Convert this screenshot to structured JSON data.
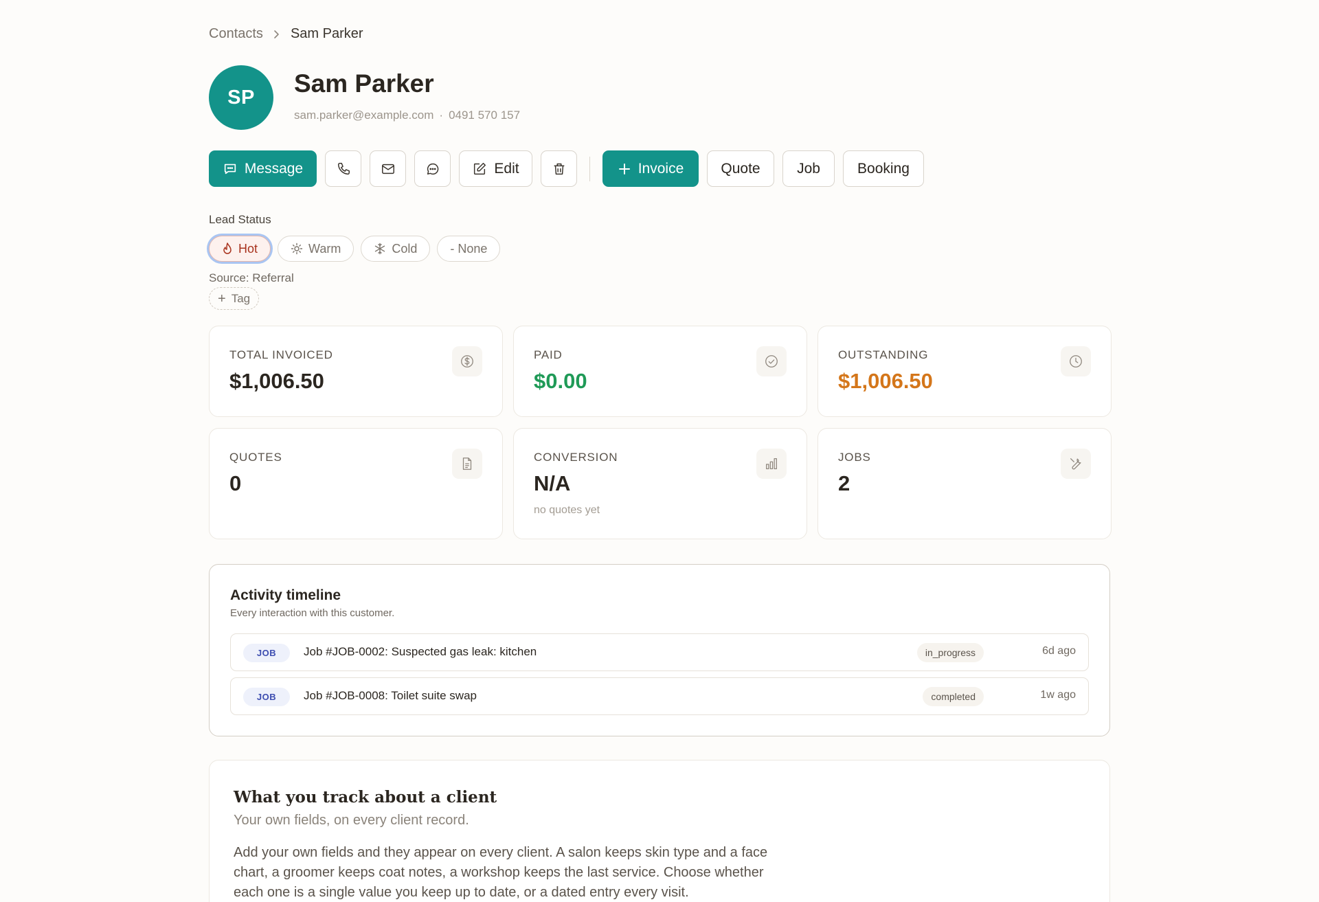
{
  "breadcrumb": {
    "parent": "Contacts",
    "current": "Sam Parker"
  },
  "contact": {
    "initials": "SP",
    "name": "Sam Parker",
    "email": "sam.parker@example.com",
    "separator": "·",
    "phone": "0491 570 157"
  },
  "actions": {
    "message": "Message",
    "edit": "Edit",
    "invoice": "Invoice",
    "quote": "Quote",
    "job": "Job",
    "booking": "Booking",
    "icons": [
      "chat-bubble-icon",
      "phone-icon",
      "mail-icon",
      "sms-icon",
      "pencil-icon",
      "trash-icon",
      "plus-icon"
    ]
  },
  "lead_status": {
    "label": "Lead Status",
    "options": [
      {
        "label": "Hot",
        "icon": "flame-icon",
        "selected": true
      },
      {
        "label": "Warm",
        "icon": "sun-icon",
        "selected": false
      },
      {
        "label": "Cold",
        "icon": "snowflake-icon",
        "selected": false
      },
      {
        "label": "- None",
        "icon": "",
        "selected": false
      }
    ]
  },
  "source": "Source: Referral",
  "tag_button": {
    "plus": "+",
    "label": "Tag"
  },
  "stats": [
    {
      "label": "TOTAL INVOICED",
      "value": "$1,006.50",
      "icon": "dollar-circle-icon",
      "color": "#2b2620"
    },
    {
      "label": "PAID",
      "value": "$0.00",
      "icon": "check-circle-icon",
      "color": "#1f9a57"
    },
    {
      "label": "OUTSTANDING",
      "value": "$1,006.50",
      "icon": "clock-icon",
      "color": "#d4761a"
    },
    {
      "label": "QUOTES",
      "value": "0",
      "icon": "document-icon",
      "color": "#2b2620"
    },
    {
      "label": "CONVERSION",
      "value": "N/A",
      "sub": "no quotes yet",
      "icon": "bar-chart-icon",
      "color": "#2b2620"
    },
    {
      "label": "JOBS",
      "value": "2",
      "icon": "wrench-icon",
      "color": "#2b2620"
    }
  ],
  "activity": {
    "title": "Activity timeline",
    "subtitle": "Every interaction with this customer.",
    "rows": [
      {
        "badge": "JOB",
        "text": "Job #JOB-0002: Suspected gas leak: kitchen",
        "status": "in_progress",
        "time": "6d ago"
      },
      {
        "badge": "JOB",
        "text": "Job #JOB-0008: Toilet suite swap",
        "status": "completed",
        "time": "1w ago"
      }
    ]
  },
  "custom_fields": {
    "title": "What you track about a client",
    "subtitle": "Your own fields, on every client record.",
    "body": "Add your own fields and they appear on every client. A salon keeps skin type and a face chart, a groomer keeps coat notes, a workshop keeps the last service. Choose whether each one is a single value you keep up to date, or a dated entry every visit."
  },
  "colors": {
    "brand": "#13938a",
    "hot": "#a8321d",
    "paid": "#1f9a57",
    "outstanding": "#d4761a"
  }
}
